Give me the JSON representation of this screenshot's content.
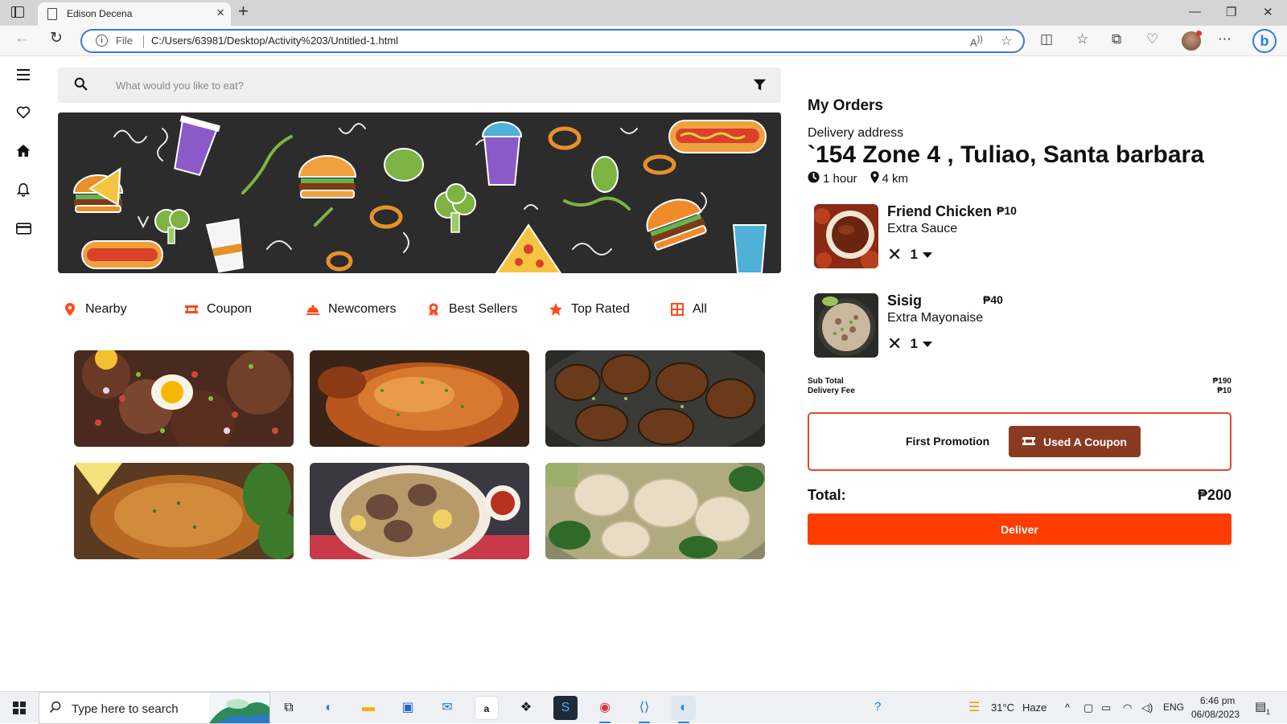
{
  "browser": {
    "tab_title": "Edison Decena",
    "url_scheme_label": "File",
    "url": "C:/Users/63981/Desktop/Activity%203/Untitled-1.html"
  },
  "search": {
    "placeholder": "What would you like to eat?"
  },
  "sidebar": {
    "icons": [
      "menu-icon",
      "heart-icon",
      "home-icon",
      "bell-icon",
      "card-icon"
    ]
  },
  "categories": [
    {
      "label": "Nearby",
      "icon": "location-pin-icon"
    },
    {
      "label": "Coupon",
      "icon": "ticket-icon"
    },
    {
      "label": "Newcomers",
      "icon": "cloche-icon"
    },
    {
      "label": "Best Sellers",
      "icon": "award-icon"
    },
    {
      "label": "Top Rated",
      "icon": "star-icon"
    },
    {
      "label": "All",
      "icon": "grid-icon"
    }
  ],
  "orders": {
    "title": "My Orders",
    "address_label": "Delivery address",
    "address": "`154 Zone 4 , Tuliao, Santa barbara",
    "eta_time": "1 hour",
    "eta_distance": "4 km",
    "items": [
      {
        "name": "Friend Chicken",
        "price": "₱10",
        "extra": "Extra Sauce",
        "qty": "1"
      },
      {
        "name": "Sisig",
        "price": "₱40",
        "extra": "Extra Mayonaise",
        "qty": "1"
      }
    ],
    "subtotal_label": "Sub Total",
    "subtotal_value": "₱190",
    "delivery_label": "Delivery Fee",
    "delivery_value": "₱10",
    "promo_label": "First Promotion",
    "coupon_button": "Used A Coupon",
    "total_label": "Total:",
    "total_value": "₱200",
    "deliver_button": "Deliver"
  },
  "colors": {
    "accent": "#ff3c00",
    "coupon": "#8b3a22",
    "icon_orange": "#ff4a1c"
  },
  "taskbar": {
    "search_text": "Type here to search",
    "weather_temp": "31°C",
    "weather_text": "Haze",
    "lang": "ENG",
    "time": "6:46 pm",
    "date": "06/08/2023",
    "notification_count": "1"
  }
}
